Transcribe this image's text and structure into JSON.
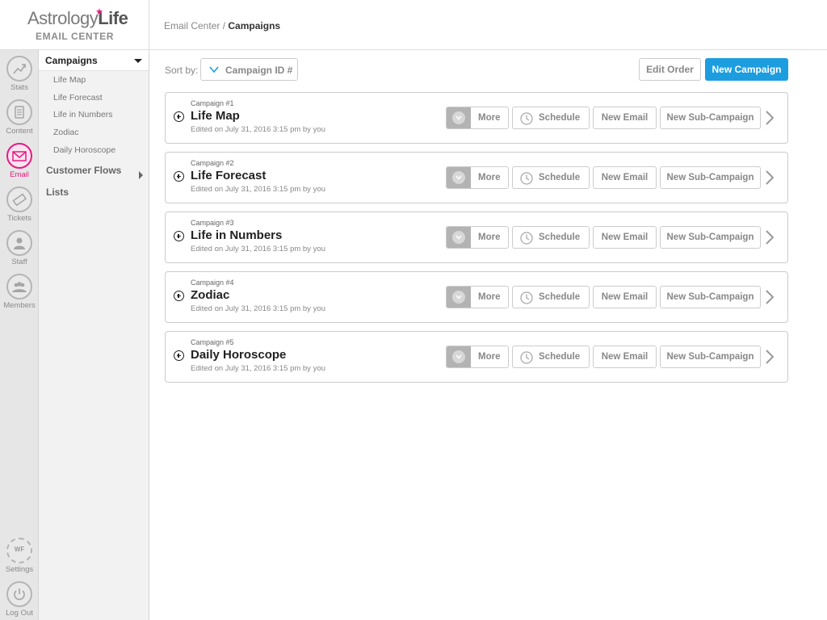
{
  "brand": {
    "logo_part1": "Astrology",
    "logo_part2": "Life",
    "subtitle": "EMAIL CENTER"
  },
  "rail": {
    "items": [
      {
        "label": "Stats",
        "icon": "trend-icon"
      },
      {
        "label": "Content",
        "icon": "document-icon"
      },
      {
        "label": "Email",
        "icon": "envelope-icon",
        "active": true
      },
      {
        "label": "Tickets",
        "icon": "ticket-icon"
      },
      {
        "label": "Staff",
        "icon": "person-icon"
      },
      {
        "label": "Members",
        "icon": "group-icon"
      }
    ],
    "settings": {
      "label": "Settings",
      "badge": "WF",
      "icon": "gear-icon"
    },
    "logout": {
      "label": "Log Out",
      "icon": "power-icon"
    }
  },
  "subnav": {
    "campaigns_label": "Campaigns",
    "campaign_items": [
      "Life Map",
      "Life Forecast",
      "Life in Numbers",
      "Zodiac",
      "Daily Horoscope"
    ],
    "customer_flows_label": "Customer Flows",
    "lists_label": "Lists"
  },
  "header": {
    "breadcrumb_root": "Email Center",
    "separator": "/",
    "current": "Campaigns"
  },
  "toolbar": {
    "sort_label": "Sort by:",
    "sort_value": "Campaign ID #",
    "edit_order": "Edit Order",
    "new_campaign": "New Campaign"
  },
  "card_actions": {
    "more": "More",
    "schedule": "Schedule",
    "new_email": "New Email",
    "new_sub": "New Sub-Campaign"
  },
  "campaigns": [
    {
      "number": "Campaign #1",
      "title": "Life Map",
      "edited": "Edited on July 31, 2016 3:15 pm by you"
    },
    {
      "number": "Campaign #2",
      "title": "Life Forecast",
      "edited": "Edited on July 31, 2016 3:15 pm by you"
    },
    {
      "number": "Campaign #3",
      "title": "Life in Numbers",
      "edited": "Edited on July 31, 2016 3:15 pm by you"
    },
    {
      "number": "Campaign #4",
      "title": "Zodiac",
      "edited": "Edited on July 31, 2016 3:15 pm by you"
    },
    {
      "number": "Campaign #5",
      "title": "Daily Horoscope",
      "edited": "Edited on July 31, 2016 3:15 pm by you"
    }
  ],
  "colors": {
    "accent": "#e31b82",
    "primary_button": "#1c9ddf",
    "rail_bg": "#e6e6e6",
    "subnav_bg": "#f2f2f2"
  }
}
